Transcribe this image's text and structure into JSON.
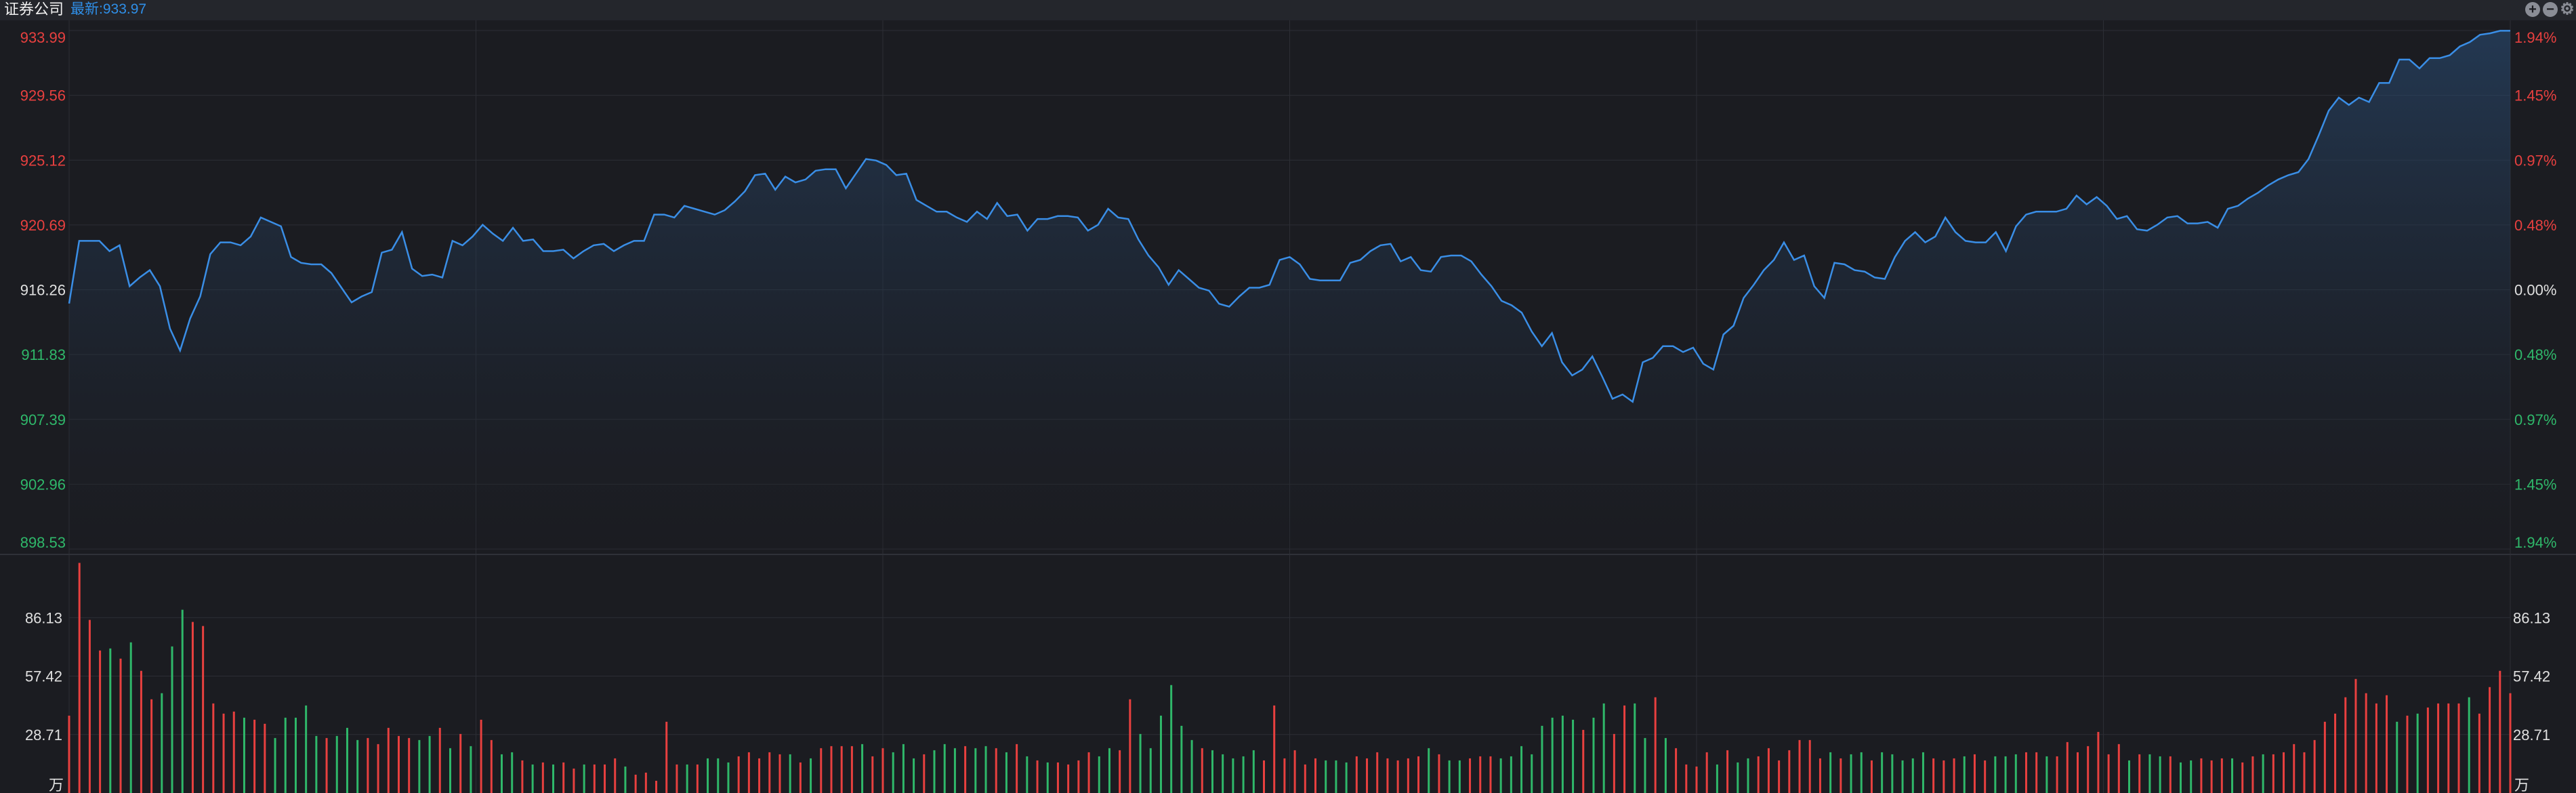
{
  "header": {
    "title": "证券公司",
    "latest_label": "最新:933.97",
    "zoom_in_icon": "plus-circle-icon",
    "zoom_out_icon": "minus-circle-icon",
    "settings_icon": "gear-icon"
  },
  "colors": {
    "background": "#1b1c21",
    "line": "#3a8ee6",
    "up": "#e8403f",
    "down": "#2fb86a",
    "neutral": "#e0e0e0",
    "grid": "#2c2e35"
  },
  "chart_data": [
    {
      "type": "area",
      "title": "证券公司",
      "base_value": 916.26,
      "ylim": [
        898.53,
        933.99
      ],
      "left_ticks": [
        "933.99",
        "929.56",
        "925.12",
        "920.69",
        "916.26",
        "911.83",
        "907.39",
        "902.96",
        "898.53"
      ],
      "right_ticks": [
        "1.94%",
        "1.45%",
        "0.97%",
        "0.48%",
        "0.00%",
        "0.48%",
        "0.97%",
        "1.45%",
        "1.94%"
      ],
      "grid": true,
      "x": [
        0,
        1,
        2,
        3,
        4,
        5,
        6,
        7,
        8,
        9,
        10,
        11,
        12,
        13,
        14,
        15,
        16,
        17,
        18,
        19,
        20,
        21,
        22,
        23,
        24,
        25,
        26,
        27,
        28,
        29,
        30,
        31,
        32,
        33,
        34,
        35,
        36,
        37,
        38,
        39,
        40,
        41,
        42,
        43,
        44,
        45,
        46,
        47,
        48,
        49,
        50,
        51,
        52,
        53,
        54,
        55,
        56,
        57,
        58,
        59,
        60,
        61,
        62,
        63,
        64,
        65,
        66,
        67,
        68,
        69,
        70,
        71,
        72,
        73,
        74,
        75,
        76,
        77,
        78,
        79,
        80,
        81,
        82,
        83,
        84,
        85,
        86,
        87,
        88,
        89,
        90,
        91,
        92,
        93,
        94,
        95,
        96,
        97,
        98,
        99,
        100,
        101,
        102,
        103,
        104,
        105,
        106,
        107,
        108,
        109,
        110,
        111,
        112,
        113,
        114,
        115,
        116,
        117,
        118,
        119,
        120,
        121,
        122,
        123,
        124,
        125,
        126,
        127,
        128,
        129,
        130,
        131,
        132,
        133,
        134,
        135,
        136,
        137,
        138,
        139,
        140,
        141,
        142,
        143,
        144,
        145,
        146,
        147,
        148,
        149,
        150,
        151,
        152,
        153,
        154,
        155,
        156,
        157,
        158,
        159,
        160,
        161,
        162,
        163,
        164,
        165,
        166,
        167,
        168,
        169,
        170,
        171,
        172,
        173,
        174,
        175,
        176,
        177,
        178,
        179,
        180,
        181,
        182,
        183,
        184,
        185,
        186,
        187,
        188,
        189,
        190,
        191,
        192,
        193,
        194,
        195,
        196,
        197,
        198,
        199,
        200,
        201,
        202,
        203,
        204,
        205,
        206,
        207,
        208,
        209,
        210,
        211,
        212,
        213,
        214,
        215,
        216,
        217,
        218,
        219,
        220,
        221,
        222,
        223,
        224,
        225,
        226,
        227,
        228,
        229,
        230,
        231,
        232,
        233,
        234,
        235,
        236,
        237,
        238,
        239,
        240
      ],
      "values": [
        915.32,
        919.6,
        919.6,
        919.6,
        918.9,
        919.3,
        916.5,
        917.1,
        917.6,
        916.5,
        913.6,
        912.1,
        914.3,
        915.8,
        918.7,
        919.5,
        919.5,
        919.3,
        919.9,
        921.2,
        920.9,
        920.6,
        918.5,
        918.1,
        918.0,
        918.0,
        917.4,
        916.4,
        915.4,
        915.8,
        916.1,
        918.8,
        919.0,
        920.2,
        917.7,
        917.2,
        917.3,
        917.1,
        919.6,
        919.3,
        919.9,
        920.7,
        920.1,
        919.6,
        920.5,
        919.6,
        919.7,
        918.9,
        918.9,
        919.0,
        918.4,
        918.9,
        919.3,
        919.4,
        918.9,
        919.3,
        919.6,
        919.6,
        921.4,
        921.4,
        921.2,
        922.0,
        921.8,
        921.6,
        921.4,
        921.7,
        922.3,
        923.0,
        924.1,
        924.2,
        923.1,
        924.0,
        923.6,
        923.8,
        924.4,
        924.5,
        924.5,
        923.2,
        924.2,
        925.2,
        925.1,
        924.8,
        924.1,
        924.2,
        922.4,
        922.0,
        921.6,
        921.6,
        921.2,
        920.9,
        921.6,
        921.1,
        922.2,
        921.3,
        921.4,
        920.3,
        921.1,
        921.1,
        921.3,
        921.3,
        921.2,
        920.3,
        920.7,
        921.8,
        921.2,
        921.1,
        919.7,
        918.6,
        917.8,
        916.6,
        917.6,
        917.0,
        916.4,
        916.2,
        915.3,
        915.1,
        915.8,
        916.4,
        916.4,
        916.6,
        918.3,
        918.5,
        918.0,
        917.0,
        916.9,
        916.9,
        916.9,
        918.1,
        918.3,
        918.9,
        919.3,
        919.4,
        918.2,
        918.5,
        917.6,
        917.5,
        918.5,
        918.6,
        918.6,
        918.2,
        917.3,
        916.5,
        915.5,
        915.2,
        914.7,
        913.4,
        912.4,
        913.3,
        911.3,
        910.4,
        910.8,
        911.7,
        910.3,
        908.8,
        909.1,
        908.6,
        911.3,
        911.6,
        912.4,
        912.4,
        912.0,
        912.3,
        911.2,
        910.8,
        913.2,
        913.8,
        915.7,
        916.6,
        917.6,
        918.3,
        919.5,
        918.3,
        918.6,
        916.5,
        915.7,
        918.1,
        918.0,
        917.6,
        917.5,
        917.1,
        917.0,
        918.5,
        919.6,
        920.2,
        919.5,
        919.9,
        921.2,
        920.2,
        919.6,
        919.5,
        919.5,
        920.2,
        918.9,
        920.6,
        921.4,
        921.6,
        921.6,
        921.6,
        921.8,
        922.7,
        922.1,
        922.6,
        922.0,
        921.1,
        921.3,
        920.4,
        920.3,
        920.7,
        921.2,
        921.3,
        920.8,
        920.8,
        920.9,
        920.5,
        921.8,
        922.0,
        922.5,
        922.9,
        923.4,
        923.8,
        924.1,
        924.3,
        925.2,
        926.8,
        928.5,
        929.4,
        928.9,
        929.4,
        929.1,
        930.4,
        930.4,
        932.0,
        932.0,
        931.4,
        932.1,
        932.1,
        932.3,
        932.9,
        933.2,
        933.7,
        933.8,
        933.97,
        933.97
      ]
    },
    {
      "type": "bar",
      "title": "volume",
      "unit": "万",
      "ylim": [
        0,
        114.84
      ],
      "ticks": [
        "86.13",
        "57.42",
        "28.71"
      ],
      "values": [
        38,
        113,
        85,
        70,
        71,
        66,
        74,
        60,
        46,
        49,
        72,
        90,
        84,
        82,
        44,
        39,
        40,
        37,
        36,
        34,
        27,
        37,
        37,
        43,
        28,
        27,
        28,
        32,
        26,
        27,
        24,
        32,
        28,
        27,
        26,
        28,
        32,
        22,
        29,
        23,
        36,
        26,
        19,
        20,
        16,
        14,
        15,
        14,
        15,
        12,
        14,
        14,
        14,
        17,
        13,
        9,
        10,
        6,
        35,
        14,
        14,
        14,
        17,
        17,
        15,
        18,
        20,
        17,
        20,
        19,
        19,
        15,
        17,
        22,
        23,
        23,
        23,
        24,
        18,
        22,
        20,
        24,
        17,
        19,
        21,
        24,
        22,
        23,
        22,
        23,
        22,
        20,
        24,
        18,
        16,
        15,
        15,
        14,
        16,
        20,
        18,
        22,
        21,
        46,
        29,
        22,
        38,
        53,
        33,
        26,
        22,
        21,
        19,
        17,
        18,
        21,
        16,
        43,
        17,
        21,
        14,
        17,
        16,
        16,
        15,
        18,
        17,
        20,
        17,
        16,
        17,
        18,
        22,
        19,
        16,
        16,
        17,
        18,
        18,
        17,
        18,
        23,
        19,
        33,
        37,
        38,
        36,
        31,
        37,
        44,
        29,
        43,
        44,
        27,
        47,
        27,
        22,
        14,
        13,
        20,
        14,
        21,
        15,
        17,
        18,
        22,
        16,
        21,
        26,
        26,
        17,
        20,
        17,
        19,
        20,
        16,
        20,
        19,
        16,
        17,
        20,
        17,
        16,
        17,
        18,
        19,
        16,
        18,
        18,
        19,
        20,
        20,
        18,
        18,
        25,
        20,
        23,
        30,
        19,
        24,
        16,
        19,
        19,
        18,
        18,
        15,
        16,
        17,
        16,
        17,
        17,
        15,
        18,
        19,
        19,
        20,
        24,
        20,
        26,
        35,
        39,
        47,
        56,
        49,
        44,
        48,
        35,
        38,
        39,
        42,
        44,
        44,
        44,
        47,
        39,
        52,
        60,
        49
      ]
    }
  ]
}
